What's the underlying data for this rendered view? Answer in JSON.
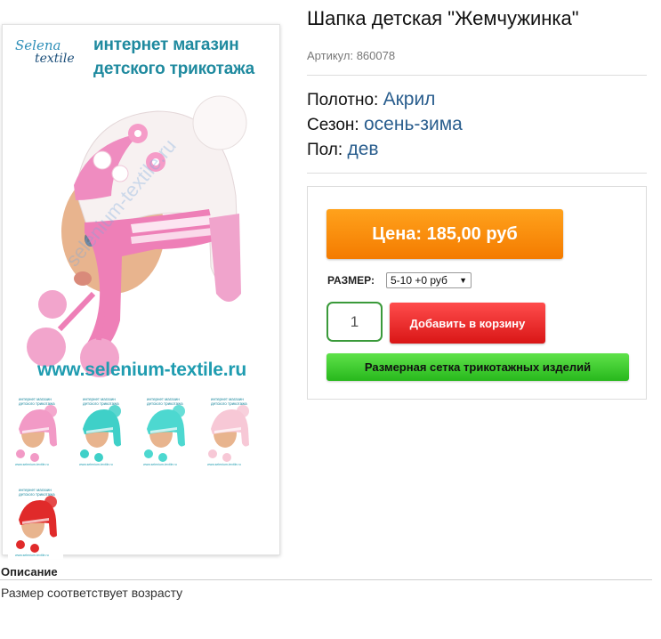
{
  "product": {
    "title": "Шапка детская \"Жемчужинка\"",
    "sku": "Артикул: 860078",
    "attributes": [
      {
        "label": "Полотно:",
        "value": "Акрил"
      },
      {
        "label": "Сезон:",
        "value": "осень-зима"
      },
      {
        "label": "Пол:",
        "value": "дев"
      }
    ]
  },
  "image": {
    "brand_line1": "Selena",
    "brand_line2": "textile",
    "shop_line1": "интернет магазин",
    "shop_line2": "детского трикотажа",
    "url": "www.selenium-textile.ru",
    "watermark": "selenium-textile.ru",
    "thumbnails": [
      {
        "color": "pink",
        "hat_color": "#f29ac6",
        "accent": "#ffffff"
      },
      {
        "color": "turquoise",
        "hat_color": "#3fd0c8",
        "accent": "#ffffff"
      },
      {
        "color": "turquoise-light",
        "hat_color": "#4dd8d0",
        "accent": "#ffffff"
      },
      {
        "color": "light-pink",
        "hat_color": "#f7c8d6",
        "accent": "#ffffff"
      },
      {
        "color": "red",
        "hat_color": "#e02a2a",
        "accent": "#ffffff"
      }
    ]
  },
  "buy": {
    "price_label": "Цена: 185,00 руб",
    "size_label": "РАЗМЕР:",
    "size_selected": "5-10 +0 руб",
    "quantity": "1",
    "add_to_cart": "Добавить в корзину",
    "size_chart": "Размерная сетка трикотажных изделий"
  },
  "description": {
    "heading": "Описание",
    "text": "Размер соответствует возрасту"
  },
  "colors": {
    "price_orange": "#f88a0a",
    "cart_red": "#e62020",
    "chart_green": "#3cc82c",
    "link_blue": "#2a5e8e",
    "qty_border_green": "#3a9a3a"
  }
}
